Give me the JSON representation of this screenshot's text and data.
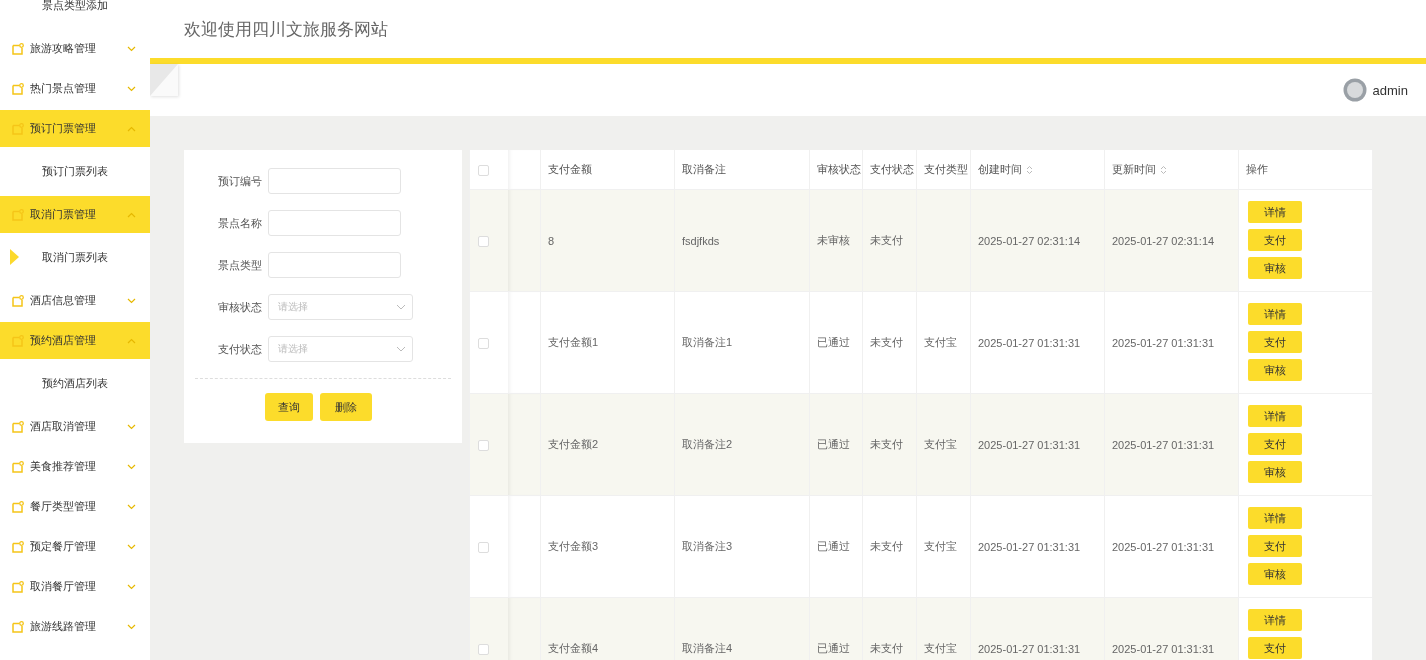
{
  "sidebar": {
    "items": [
      {
        "kind": "sub",
        "label": "景点类型添加",
        "selected": false
      },
      {
        "kind": "group",
        "label": "旅游攻略管理",
        "expanded": false
      },
      {
        "kind": "group",
        "label": "热门景点管理",
        "expanded": false
      },
      {
        "kind": "group",
        "label": "预订门票管理",
        "expanded": true,
        "children": [
          {
            "kind": "sub",
            "label": "预订门票列表",
            "selected": false
          }
        ]
      },
      {
        "kind": "group",
        "label": "取消门票管理",
        "expanded": true,
        "children": [
          {
            "kind": "sub",
            "label": "取消门票列表",
            "selected": true
          }
        ]
      },
      {
        "kind": "group",
        "label": "酒店信息管理",
        "expanded": false
      },
      {
        "kind": "group",
        "label": "预约酒店管理",
        "expanded": true,
        "children": [
          {
            "kind": "sub",
            "label": "预约酒店列表",
            "selected": false
          }
        ]
      },
      {
        "kind": "group",
        "label": "酒店取消管理",
        "expanded": false
      },
      {
        "kind": "group",
        "label": "美食推荐管理",
        "expanded": false
      },
      {
        "kind": "group",
        "label": "餐厅类型管理",
        "expanded": false
      },
      {
        "kind": "group",
        "label": "预定餐厅管理",
        "expanded": false
      },
      {
        "kind": "group",
        "label": "取消餐厅管理",
        "expanded": false
      },
      {
        "kind": "group",
        "label": "旅游线路管理",
        "expanded": false
      }
    ]
  },
  "header": {
    "title": "欢迎使用四川文旅服务网站",
    "user": "admin"
  },
  "search_form": {
    "fields": [
      {
        "kind": "input",
        "label": "预订编号"
      },
      {
        "kind": "input",
        "label": "景点名称"
      },
      {
        "kind": "input",
        "label": "景点类型"
      },
      {
        "kind": "select",
        "label": "审核状态",
        "placeholder": "请选择"
      },
      {
        "kind": "select",
        "label": "支付状态",
        "placeholder": "请选择"
      }
    ],
    "buttons": [
      "查询",
      "删除"
    ]
  },
  "table": {
    "all_checked": false,
    "columns": [
      {
        "label": "支付金额",
        "sortable": false
      },
      {
        "label": "取消备注",
        "sortable": false
      },
      {
        "label": "审核状态",
        "sortable": false
      },
      {
        "label": "支付状态",
        "sortable": false
      },
      {
        "label": "支付类型",
        "sortable": false
      },
      {
        "label": "创建时间",
        "sortable": true
      },
      {
        "label": "更新时间",
        "sortable": true
      },
      {
        "label": "操作",
        "sortable": false
      }
    ],
    "rows": [
      {
        "checked": false,
        "cells": [
          "8",
          "fsdjfkds",
          "未审核",
          "未支付",
          "",
          "2025-01-27 02:31:14",
          "2025-01-27 02:31:14"
        ],
        "actions": [
          "详情",
          "支付",
          "审核"
        ]
      },
      {
        "checked": false,
        "cells": [
          "支付金额1",
          "取消备注1",
          "已通过",
          "未支付",
          "支付宝",
          "2025-01-27 01:31:31",
          "2025-01-27 01:31:31"
        ],
        "actions": [
          "详情",
          "支付",
          "审核"
        ]
      },
      {
        "checked": false,
        "cells": [
          "支付金额2",
          "取消备注2",
          "已通过",
          "未支付",
          "支付宝",
          "2025-01-27 01:31:31",
          "2025-01-27 01:31:31"
        ],
        "actions": [
          "详情",
          "支付",
          "审核"
        ]
      },
      {
        "checked": false,
        "cells": [
          "支付金额3",
          "取消备注3",
          "已通过",
          "未支付",
          "支付宝",
          "2025-01-27 01:31:31",
          "2025-01-27 01:31:31"
        ],
        "actions": [
          "详情",
          "支付",
          "审核"
        ]
      },
      {
        "checked": false,
        "cells": [
          "支付金额4",
          "取消备注4",
          "已通过",
          "未支付",
          "支付宝",
          "2025-01-27 01:31:31",
          "2025-01-27 01:31:31"
        ],
        "actions": [
          "详情",
          "支付"
        ]
      }
    ]
  }
}
